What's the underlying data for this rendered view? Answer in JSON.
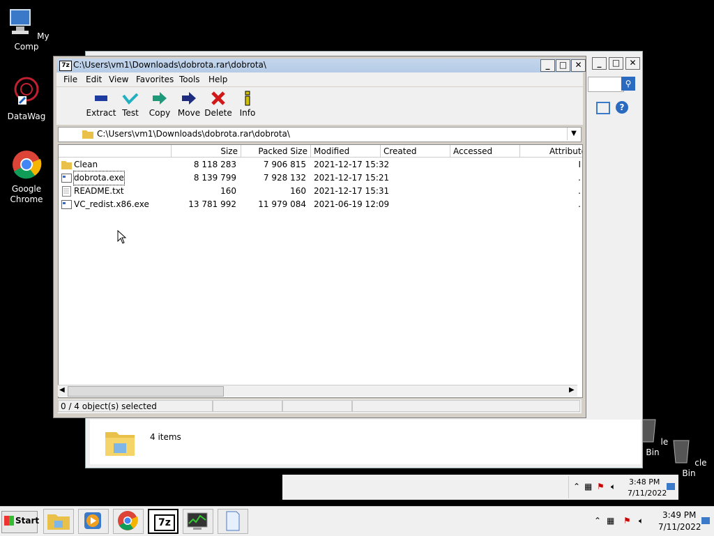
{
  "desktop": {
    "icons": [
      {
        "label": "My Comp"
      },
      {
        "label": "DataWag"
      },
      {
        "label": "Google Chrome"
      },
      {
        "label": "le Bin"
      },
      {
        "label": "cle Bin"
      }
    ]
  },
  "bg_window": {
    "items_count": "4 items",
    "clock_time": "3:48 PM",
    "clock_date": "7/11/2022"
  },
  "sevenzip": {
    "title": "C:\\Users\\vm1\\Downloads\\dobrota.rar\\dobrota\\",
    "menu": [
      "File",
      "Edit",
      "View",
      "Favorites",
      "Tools",
      "Help"
    ],
    "toolbar": [
      {
        "label": "Extract",
        "icon": "minus-icon",
        "color": "#1e3ca0"
      },
      {
        "label": "Test",
        "icon": "check-icon",
        "color": "#22b0c0"
      },
      {
        "label": "Copy",
        "icon": "arrow-right-icon",
        "color": "#1e9a7a"
      },
      {
        "label": "Move",
        "icon": "arrow-right-icon",
        "color": "#1e2c80"
      },
      {
        "label": "Delete",
        "icon": "x-icon",
        "color": "#d01818"
      },
      {
        "label": "Info",
        "icon": "info-icon",
        "color": "#d0c000"
      }
    ],
    "address": "C:\\Users\\vm1\\Downloads\\dobrota.rar\\dobrota\\",
    "columns": [
      "Size",
      "Packed Size",
      "Modified",
      "Created",
      "Accessed",
      "Attribute"
    ],
    "files": [
      {
        "name": "Clean",
        "type": "folder",
        "size": "8 118 283",
        "packed": "7 906 815",
        "modified": "2021-12-17 15:32",
        "attr": "I"
      },
      {
        "name": "dobrota.exe",
        "type": "exe",
        "size": "8 139 799",
        "packed": "7 928 132",
        "modified": "2021-12-17 15:21",
        "attr": "."
      },
      {
        "name": "README.txt",
        "type": "txt",
        "size": "160",
        "packed": "160",
        "modified": "2021-12-17 15:31",
        "attr": "."
      },
      {
        "name": "VC_redist.x86.exe",
        "type": "exe",
        "size": "13 781 992",
        "packed": "11 979 084",
        "modified": "2021-06-19 12:09",
        "attr": "."
      }
    ],
    "status": "0 / 4 object(s) selected"
  },
  "taskbar": {
    "start_label": "Start",
    "clock_time": "3:49 PM",
    "clock_date": "7/11/2022"
  }
}
